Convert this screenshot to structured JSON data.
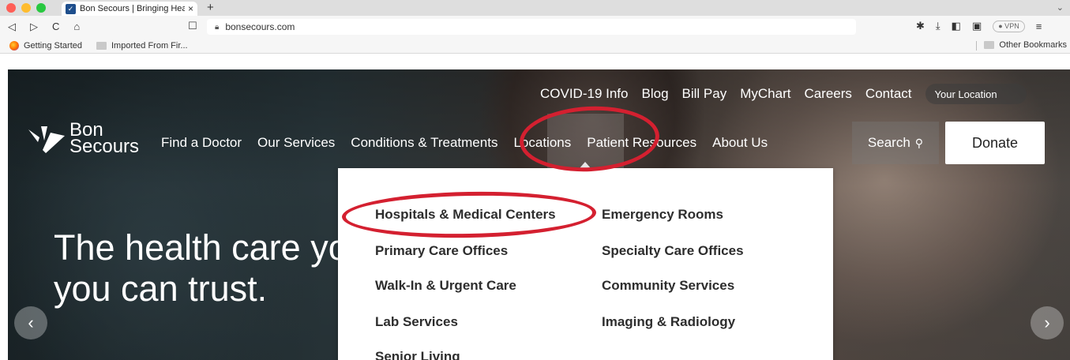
{
  "browser": {
    "tab_title": "Bon Secours | Bringing Health C",
    "tab_close": "×",
    "new_tab": "+",
    "tab_menu": "⌄",
    "nav_back": "◁",
    "nav_forward": "▷",
    "nav_reload": "C",
    "nav_home": "⌂",
    "bookmark_icon": "☐",
    "url": "bonsecours.com",
    "vpn_label": "● VPN",
    "bookmarks": [
      {
        "label": "Getting Started"
      },
      {
        "label": "Imported From Fir..."
      }
    ],
    "other_bookmarks": "Other Bookmarks",
    "traffic_colors": [
      "#ff5f57",
      "#febc2e",
      "#28c840"
    ]
  },
  "site": {
    "utility_links": [
      "COVID-19 Info",
      "Blog",
      "Bill Pay",
      "MyChart",
      "Careers",
      "Contact"
    ],
    "location_button": "Your Location",
    "logo_line1": "Bon",
    "logo_line2": "Secours",
    "main_nav": {
      "find_doctor": "Find a Doctor",
      "our_services": "Our Services",
      "conditions": "Conditions & Treatments",
      "locations": "Locations",
      "patient_resources": "Patient Resources",
      "about_us": "About Us"
    },
    "search_label": "Search",
    "donate_label": "Donate",
    "hero_line1": "The health care yo",
    "hero_line2": "you can trust.",
    "prev_arrow": "‹",
    "next_arrow": "›"
  },
  "dropdown": {
    "left_column": [
      "Hospitals & Medical Centers",
      "Primary Care Offices",
      "Walk-In & Urgent Care",
      "Lab Services",
      "Senior Living"
    ],
    "right_column": [
      "Emergency Rooms",
      "Specialty Care Offices",
      "Community Services",
      "Imaging & Radiology"
    ]
  },
  "colors": {
    "annotation_red": "#d42030",
    "brand_blue": "#1e4e8c"
  }
}
